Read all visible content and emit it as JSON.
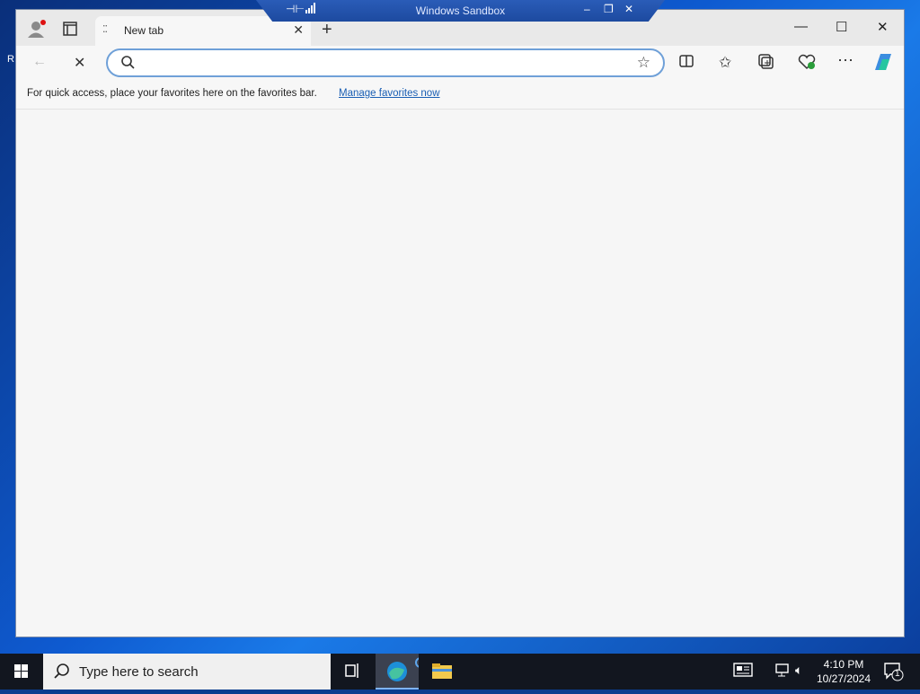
{
  "desktop": {
    "edge_letter": "R"
  },
  "sandbox": {
    "title": "Windows Sandbox"
  },
  "browser": {
    "tab": {
      "title": "New tab"
    },
    "address": {
      "value": "",
      "placeholder": ""
    },
    "favorites_bar": {
      "message": "For quick access, place your favorites here on the favorites bar.",
      "link": "Manage favorites now"
    }
  },
  "taskbar": {
    "search_placeholder": "Type here to search",
    "time": "4:10 PM",
    "date": "10/27/2024",
    "notification_count": "1"
  }
}
